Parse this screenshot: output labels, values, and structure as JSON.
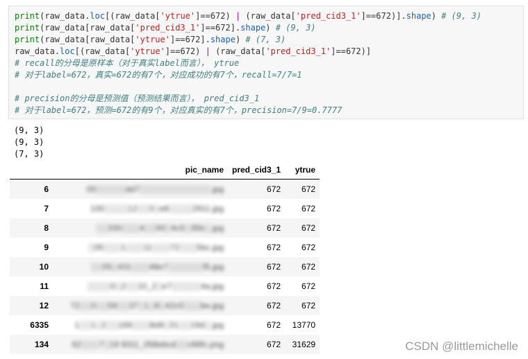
{
  "code_lines": [
    [
      [
        "k",
        "print"
      ],
      [
        "n",
        "(raw_data."
      ],
      [
        "a",
        "loc"
      ],
      [
        "n",
        "[(raw_data["
      ],
      [
        "s",
        "'ytrue'"
      ],
      [
        "n",
        "]=="
      ],
      [
        "n",
        "672"
      ],
      [
        "n",
        ") "
      ],
      [
        "o",
        "|"
      ],
      [
        "n",
        " (raw_data["
      ],
      [
        "s",
        "'pred_cid3_1'"
      ],
      [
        "n",
        "]=="
      ],
      [
        "n",
        "672"
      ],
      [
        "n",
        ")]."
      ],
      [
        "a",
        "shape"
      ],
      [
        "n",
        ") "
      ],
      [
        "c",
        "# (9, 3)"
      ]
    ],
    [
      [
        "k",
        "print"
      ],
      [
        "n",
        "(raw_data[raw_data["
      ],
      [
        "s",
        "'pred_cid3_1'"
      ],
      [
        "n",
        "]=="
      ],
      [
        "n",
        "672"
      ],
      [
        "n",
        "]."
      ],
      [
        "a",
        "shape"
      ],
      [
        "n",
        ") "
      ],
      [
        "c",
        "# (9, 3)"
      ]
    ],
    [
      [
        "k",
        "print"
      ],
      [
        "n",
        "(raw_data[raw_data["
      ],
      [
        "s",
        "'ytrue'"
      ],
      [
        "n",
        "]=="
      ],
      [
        "n",
        "672"
      ],
      [
        "n",
        "]."
      ],
      [
        "a",
        "shape"
      ],
      [
        "n",
        ") "
      ],
      [
        "c",
        "# (7, 3)"
      ]
    ],
    [
      [
        "n",
        "raw_data."
      ],
      [
        "a",
        "loc"
      ],
      [
        "n",
        "[(raw_data["
      ],
      [
        "s",
        "'ytrue'"
      ],
      [
        "n",
        "]=="
      ],
      [
        "n",
        "672"
      ],
      [
        "n",
        ") "
      ],
      [
        "o",
        "|"
      ],
      [
        "n",
        " (raw_data["
      ],
      [
        "s",
        "'pred_cid3_1'"
      ],
      [
        "n",
        "]=="
      ],
      [
        "n",
        "672"
      ],
      [
        "n",
        ")]"
      ]
    ],
    [
      [
        "c",
        "# recall的分母是原样本（对于真实label而言）， ytrue"
      ]
    ],
    [
      [
        "c",
        "# 对于label=672，真实=672的有7个，对应成功的有7个，recall=7/7=1"
      ]
    ],
    [
      [
        "n",
        ""
      ]
    ],
    [
      [
        "c",
        "# precision的分母是预测值（预测结果而言）， pred_cid3_1"
      ]
    ],
    [
      [
        "c",
        "# 对于label=672，预测=672的有9个，对应真实的有7个，precision=7/9=0.7777"
      ]
    ]
  ],
  "output_lines": [
    "(9, 3)",
    "(9, 3)",
    "(7, 3)"
  ],
  "table": {
    "columns": [
      "",
      "pic_name",
      "pred_cid3_1",
      "ytrue"
    ],
    "rows": [
      {
        "index": "6",
        "pic_name": "00░░░░░dd7░░░░░░░░░░░░.jpg",
        "pred_cid3_1": "672",
        "ytrue": "672"
      },
      {
        "index": "7",
        "pic_name": "100░░░░12░░3░e8░░░░2911.jpg",
        "pred_cid3_1": "672",
        "ytrue": "672"
      },
      {
        "index": "8",
        "pic_name": "░░330░░░4░░00░4c5░35b░.jpg",
        "pred_cid3_1": "672",
        "ytrue": "672"
      },
      {
        "index": "9",
        "pic_name": "░05░░░1░░░11░░░72░░░5bc.jpg",
        "pred_cid3_1": "672",
        "ytrue": "672"
      },
      {
        "index": "10",
        "pic_name": "░░05░431░░░48e7░░░░░░f5.jpg",
        "pred_cid3_1": "672",
        "ytrue": "672"
      },
      {
        "index": "11",
        "pic_name": "░░░░0░2░░10_2░e7░░░░░4a.jpg",
        "pred_cid3_1": "672",
        "ytrue": "672"
      },
      {
        "index": "12",
        "pic_name": "72░░0░░59░░37░1░8░42c0░░░be.jpg",
        "pred_cid3_1": "672",
        "ytrue": "672"
      },
      {
        "index": "6335",
        "pic_name": "1░░1░2░░189░░░8d9░31░░19d░.jpg",
        "pred_cid3_1": "672",
        "ytrue": "13770"
      },
      {
        "index": "134",
        "pic_name": "62░░░7░19 9311_058ebcd░░c66fc.png",
        "pred_cid3_1": "672",
        "ytrue": "31629"
      }
    ]
  },
  "watermark": "CSDN @littlemichelle"
}
